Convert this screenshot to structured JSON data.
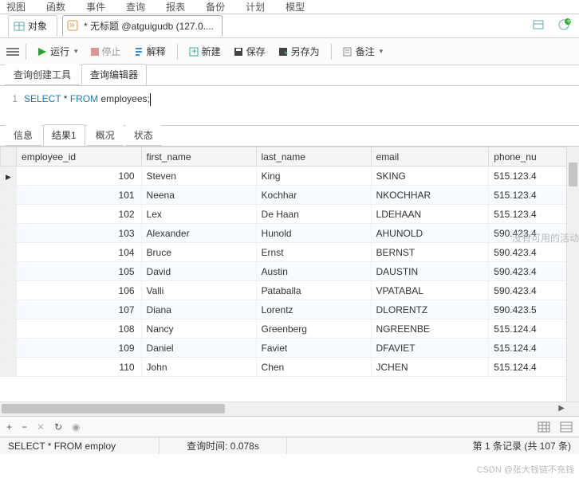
{
  "topmenu": [
    "视图",
    "函数",
    "事件",
    "查询",
    "报表",
    "备份",
    "计划",
    "模型"
  ],
  "tabs": {
    "object": "对象",
    "query": "* 无标题 @atguigudb (127.0...."
  },
  "toolbar": {
    "run": "运行",
    "stop": "停止",
    "explain": "解释",
    "new": "新建",
    "save": "保存",
    "saveAs": "另存为",
    "note": "备注"
  },
  "subtabs": {
    "builder": "查询创建工具",
    "editor": "查询编辑器"
  },
  "code": {
    "lineNo": "1",
    "kw1": "SELECT",
    "star": " * ",
    "kw2": "FROM",
    "rest": " employees;"
  },
  "resultTabs": {
    "info": "信息",
    "result": "结果1",
    "profile": "概况",
    "status": "状态"
  },
  "columns": [
    "employee_id",
    "first_name",
    "last_name",
    "email",
    "phone_nu"
  ],
  "rows": [
    {
      "id": "100",
      "fn": "Steven",
      "ln": "King",
      "em": "SKING",
      "ph": "515.123.4"
    },
    {
      "id": "101",
      "fn": "Neena",
      "ln": "Kochhar",
      "em": "NKOCHHAR",
      "ph": "515.123.4"
    },
    {
      "id": "102",
      "fn": "Lex",
      "ln": "De Haan",
      "em": "LDEHAAN",
      "ph": "515.123.4"
    },
    {
      "id": "103",
      "fn": "Alexander",
      "ln": "Hunold",
      "em": "AHUNOLD",
      "ph": "590.423.4"
    },
    {
      "id": "104",
      "fn": "Bruce",
      "ln": "Ernst",
      "em": "BERNST",
      "ph": "590.423.4"
    },
    {
      "id": "105",
      "fn": "David",
      "ln": "Austin",
      "em": "DAUSTIN",
      "ph": "590.423.4"
    },
    {
      "id": "106",
      "fn": "Valli",
      "ln": "Pataballa",
      "em": "VPATABAL",
      "ph": "590.423.4"
    },
    {
      "id": "107",
      "fn": "Diana",
      "ln": "Lorentz",
      "em": "DLORENTZ",
      "ph": "590.423.5"
    },
    {
      "id": "108",
      "fn": "Nancy",
      "ln": "Greenberg",
      "em": "NGREENBE",
      "ph": "515.124.4"
    },
    {
      "id": "109",
      "fn": "Daniel",
      "ln": "Faviet",
      "em": "DFAVIET",
      "ph": "515.124.4"
    },
    {
      "id": "110",
      "fn": "John",
      "ln": "Chen",
      "em": "JCHEN",
      "ph": "515.124.4"
    }
  ],
  "navSymbols": {
    "add": "+",
    "del": "−",
    "cancel": "✕",
    "refresh": "↻",
    "stop2": "◉"
  },
  "status": {
    "sql": "SELECT * FROM employ",
    "time": "查询时间: 0.078s",
    "count": "第 1 条记录 (共 107 条)"
  },
  "sideNote": "没有可用的活动",
  "watermark": "CSDN @张大钱链不充钱",
  "colors": {
    "run": "#2e9e2e",
    "stop": "#b33",
    "kw": "#1a7ab5"
  }
}
